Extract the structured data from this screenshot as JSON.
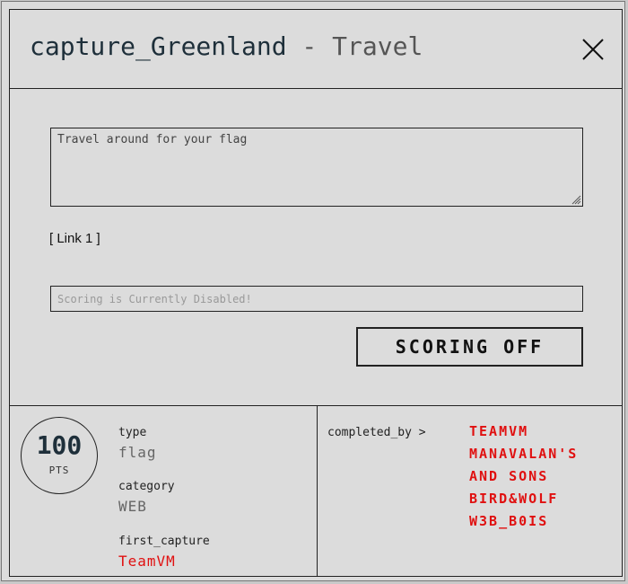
{
  "header": {
    "challenge_name": "capture_Greenland",
    "separator": " - ",
    "category_title": "Travel"
  },
  "description": "Travel around for your flag",
  "link_label": "[ Link 1 ]",
  "flag_input": {
    "placeholder": "Scoring is Currently Disabled!",
    "value": ""
  },
  "score_button": {
    "label": "SCORING OFF"
  },
  "footer": {
    "points": {
      "value": "100",
      "unit": "PTS"
    },
    "type": {
      "label": "type",
      "value": "flag"
    },
    "category": {
      "label": "category",
      "value": "WEB"
    },
    "first_capture": {
      "label": "first_capture",
      "value": "TeamVM"
    },
    "completed_by": {
      "label": "completed_by >",
      "teams": [
        "TEAMVM",
        "MANAVALAN'S AND SONS",
        "BIRD&WOLF",
        "W3B_B0IS"
      ]
    }
  },
  "colors": {
    "background": "#dcdcdc",
    "title": "#1e2f3a",
    "accent_red": "#e01010",
    "border": "#222222"
  }
}
